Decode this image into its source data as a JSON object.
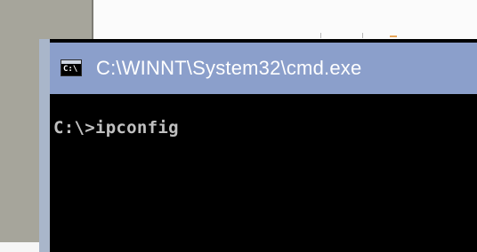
{
  "window": {
    "title": "C:\\WINNT\\System32\\cmd.exe",
    "icon_label": "C:\\"
  },
  "console": {
    "lines": [
      "C:\\>ipconfig"
    ]
  },
  "colors": {
    "titlebar": "#8b9fcb",
    "console_bg": "#000000",
    "console_text": "#c0c0c0",
    "desktop_left": "#a6a59b"
  },
  "icons": {
    "app_icon": "cmd-icon"
  }
}
